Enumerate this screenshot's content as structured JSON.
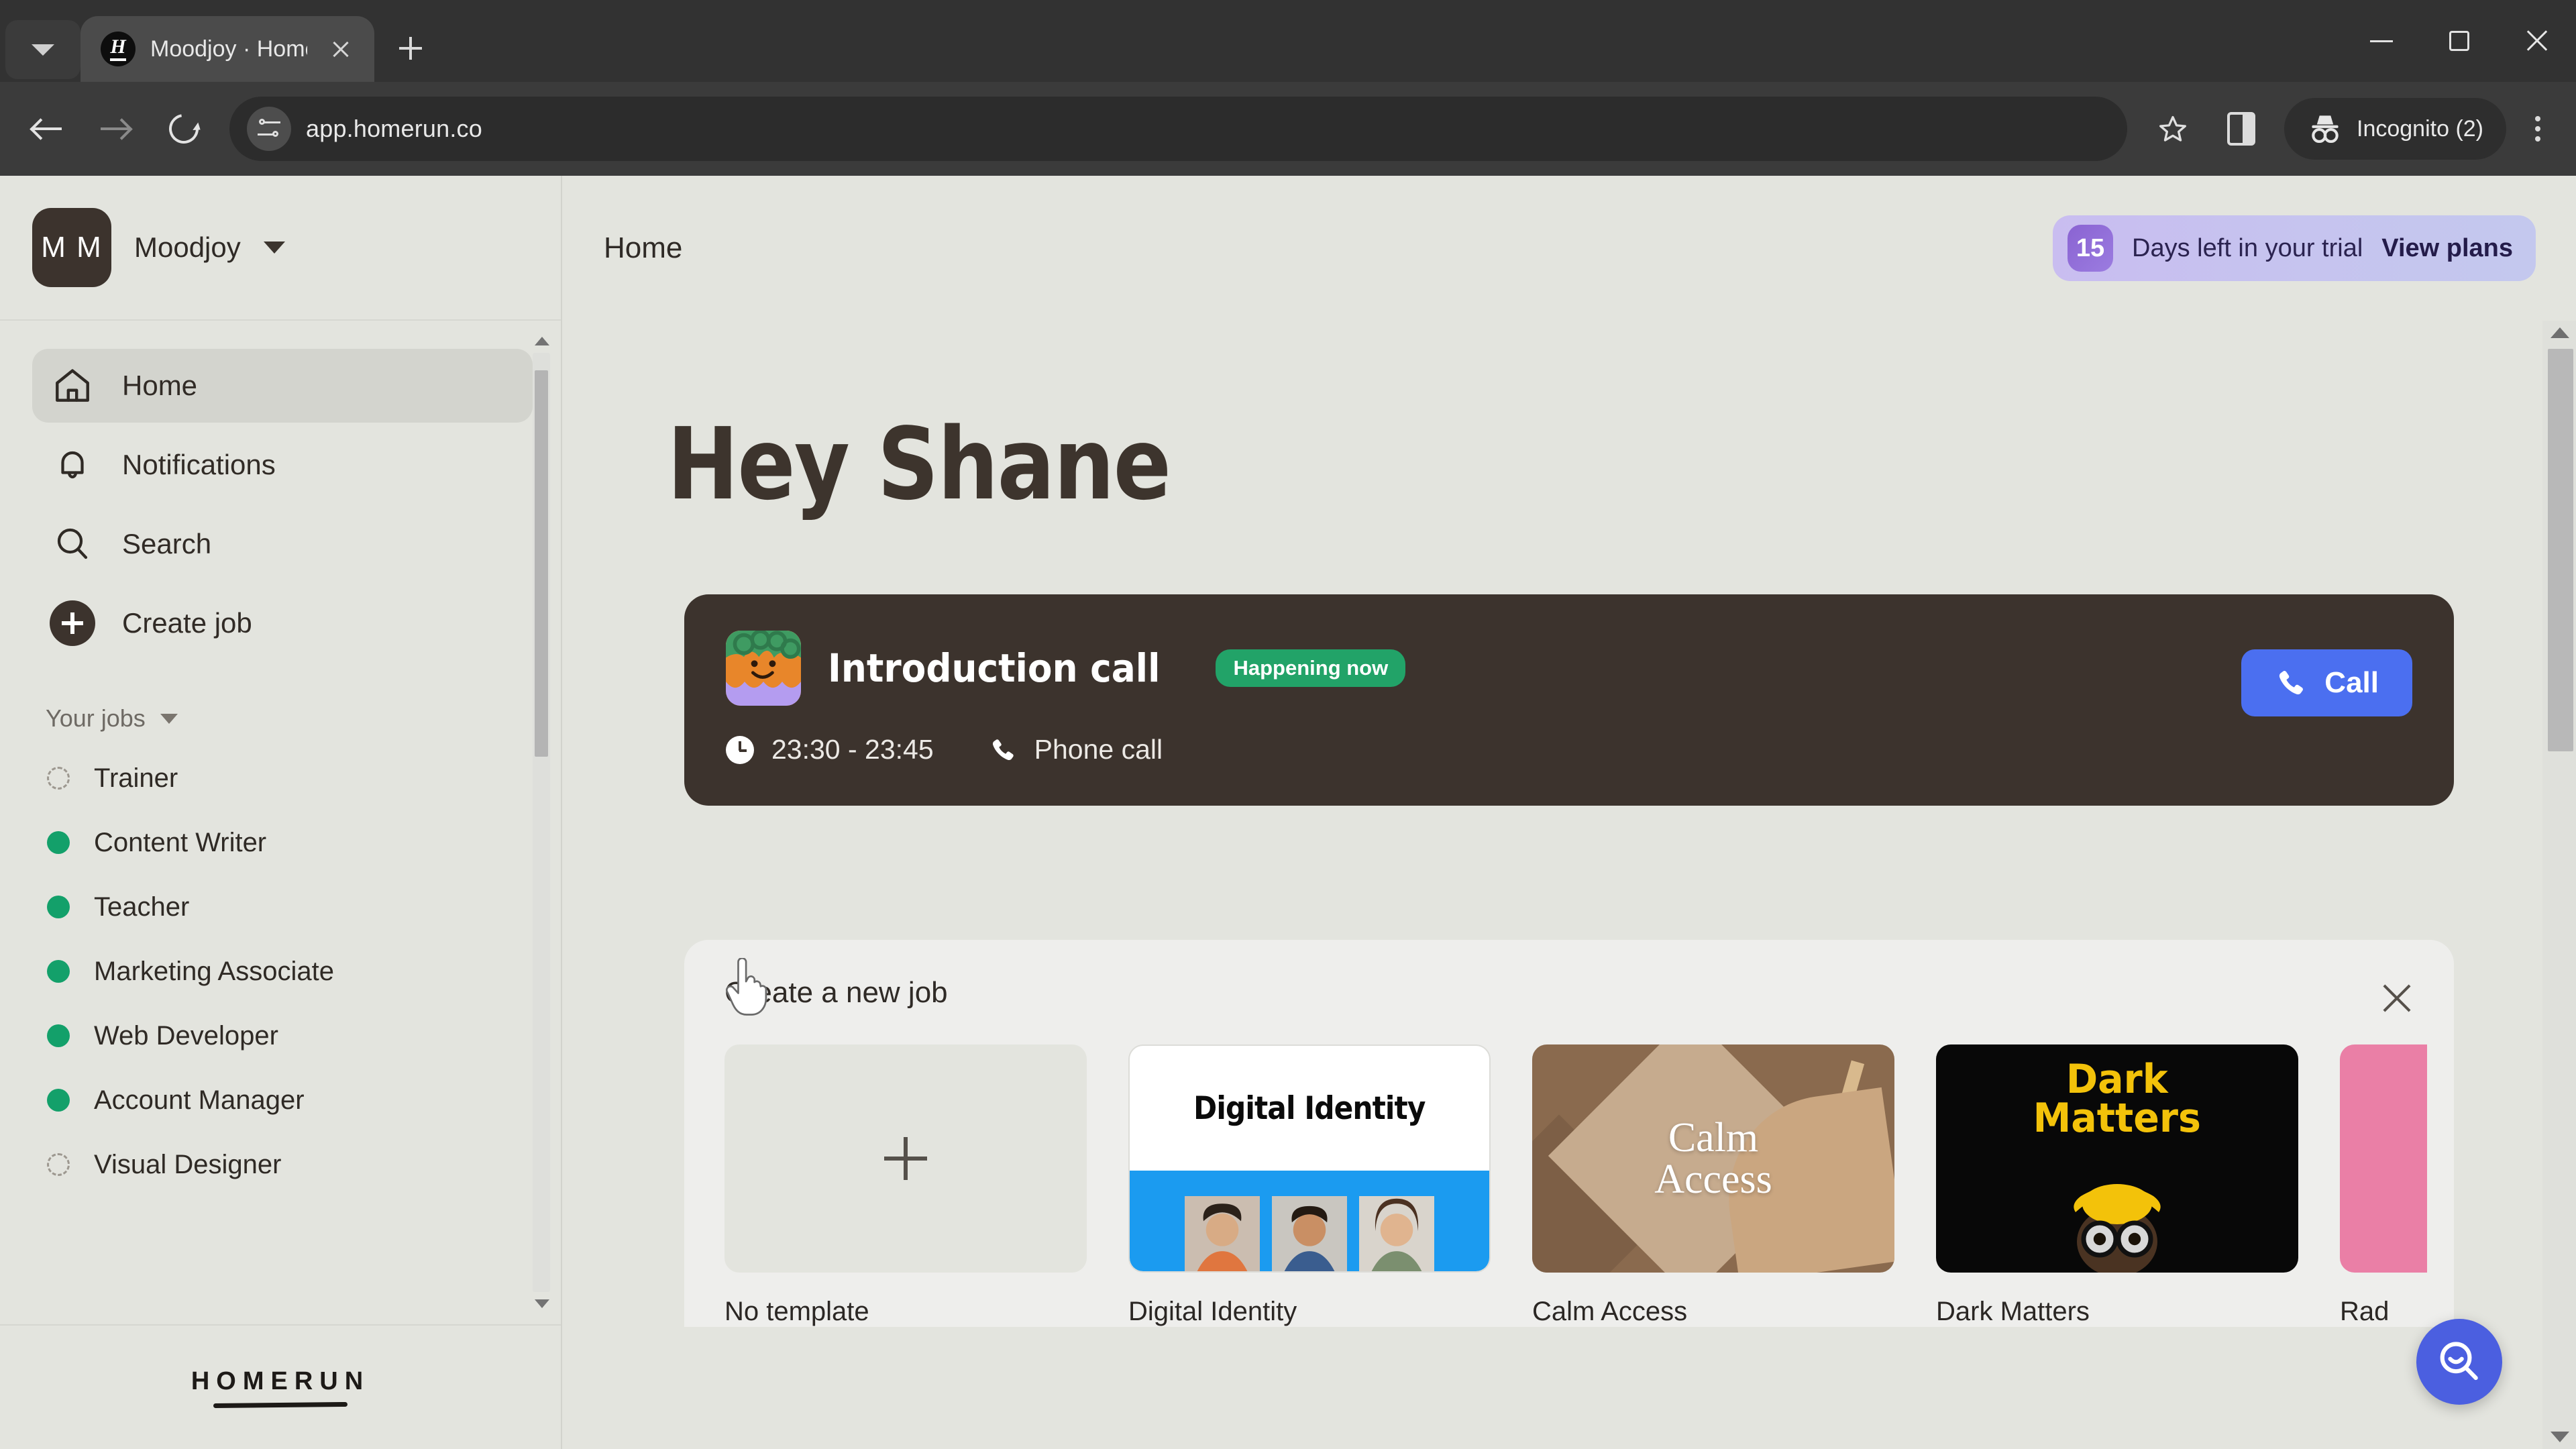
{
  "browser": {
    "tab": {
      "title": "Moodjoy · Homerun",
      "favicon_letter": "H",
      "favicon_icon": "homerun-favicon"
    },
    "tab_list_icon": "chevron-down-icon",
    "new_tab_icon": "plus-icon",
    "close_tab_icon": "close-icon",
    "window": {
      "minimize": "minimize-icon",
      "maximize": "restore-icon",
      "close": "close-icon"
    },
    "toolbar": {
      "back_icon": "back-arrow-icon",
      "forward_icon": "forward-arrow-icon",
      "reload_icon": "reload-icon",
      "site_info_icon": "site-settings-icon",
      "url": "app.homerun.co",
      "bookmark_icon": "star-icon",
      "side_panel_icon": "side-panel-icon",
      "incognito_icon": "incognito-icon",
      "incognito_label": "Incognito (2)",
      "menu_icon": "kebab-menu-icon"
    }
  },
  "sidebar": {
    "org": {
      "initials": "M M",
      "name": "Moodjoy",
      "caret_icon": "chevron-down-icon"
    },
    "nav": [
      {
        "label": "Home",
        "icon": "home-icon",
        "active": true
      },
      {
        "label": "Notifications",
        "icon": "bell-icon",
        "active": false
      },
      {
        "label": "Search",
        "icon": "search-icon",
        "active": false
      },
      {
        "label": "Create job",
        "icon": "plus-circle-icon",
        "active": false
      }
    ],
    "jobs_section": {
      "label": "Your jobs",
      "caret_icon": "chevron-down-icon"
    },
    "jobs": [
      {
        "label": "Trainer",
        "status": "draft"
      },
      {
        "label": "Content Writer",
        "status": "live"
      },
      {
        "label": "Teacher",
        "status": "live"
      },
      {
        "label": "Marketing Associate",
        "status": "live"
      },
      {
        "label": "Web Developer",
        "status": "live"
      },
      {
        "label": "Account Manager",
        "status": "live"
      },
      {
        "label": "Visual Designer",
        "status": "draft"
      }
    ],
    "footer_logo": "HOMERUN"
  },
  "topbar": {
    "title": "Home",
    "trial": {
      "days": "15",
      "text": "Days left in your trial",
      "link": "View plans"
    }
  },
  "content": {
    "greeting": "Hey Shane",
    "call_card": {
      "avatar_icon": "job-avatar-icon",
      "title": "Introduction call",
      "badge": "Happening now",
      "time_icon": "clock-icon",
      "time": "23:30 - 23:45",
      "type_icon": "phone-icon",
      "type": "Phone call",
      "button": {
        "label": "Call",
        "icon": "phone-icon",
        "color": "#4b6ff0"
      }
    },
    "panel": {
      "title": "Create a new job",
      "close_icon": "close-icon",
      "templates": [
        {
          "label": "No template",
          "kind": "none"
        },
        {
          "label": "Digital Identity",
          "kind": "digital-identity",
          "heading": "Digital Identity"
        },
        {
          "label": "Calm Access",
          "kind": "calm-access",
          "heading": "Calm Access"
        },
        {
          "label": "Dark Matters",
          "kind": "dark-matters",
          "heading": "Dark Matters"
        },
        {
          "label": "Rad",
          "kind": "pink-partial"
        }
      ]
    },
    "help_fab_icon": "search-smile-icon"
  },
  "colors": {
    "page_bg": "#e3e4de",
    "panel_bg": "#eeeeec",
    "dark_card": "#3c332d",
    "accent_blue": "#4b6ff0",
    "status_green": "#13a06a",
    "badge_green": "#22a368",
    "trial_purple": "#8a63d2"
  }
}
